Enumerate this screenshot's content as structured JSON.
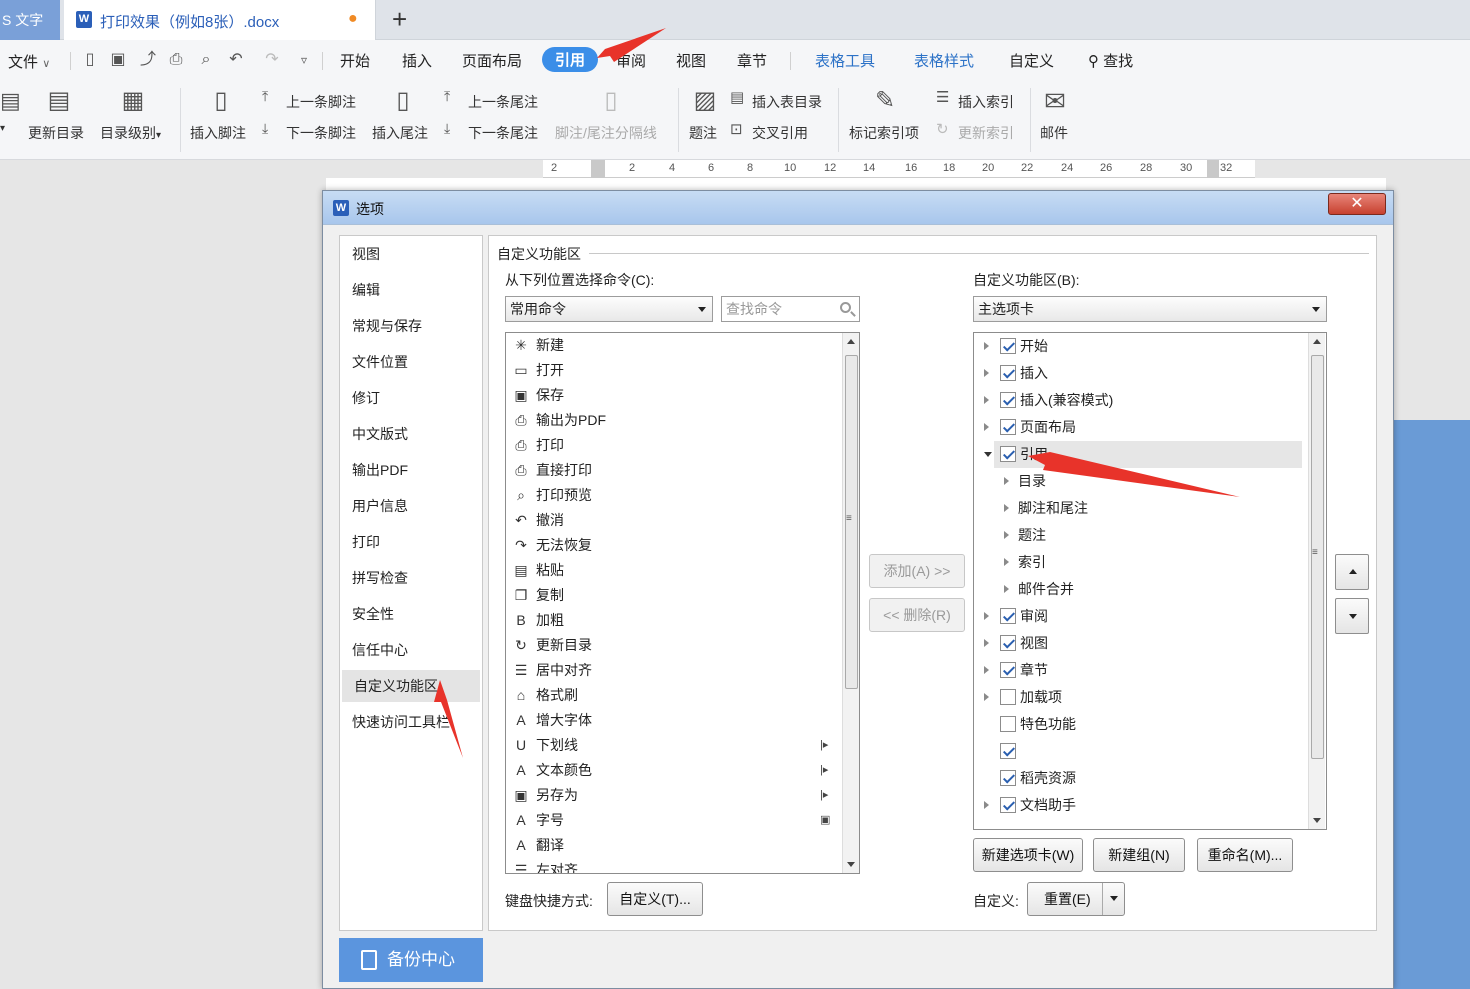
{
  "tabs": {
    "app_label": "S 文字",
    "doc_title": "打印效果（例如8张）.docx",
    "new_tab": "+"
  },
  "menu": {
    "file": "文件",
    "items": [
      "开始",
      "插入",
      "页面布局",
      "引用",
      "审阅",
      "视图",
      "章节",
      "表格工具",
      "表格样式",
      "自定义"
    ],
    "search": "查找"
  },
  "ribbon": {
    "update_toc": "更新目录",
    "toc_level": "目录级别",
    "insert_footnote": "插入脚注",
    "prev_footnote": "上一条脚注",
    "next_footnote": "下一条脚注",
    "insert_endnote": "插入尾注",
    "prev_endnote": "上一条尾注",
    "next_endnote": "下一条尾注",
    "separator": "脚注/尾注分隔线",
    "caption": "题注",
    "insert_table_of_figures": "插入表目录",
    "cross_ref": "交叉引用",
    "mark_index": "标记索引项",
    "insert_index": "插入索引",
    "update_index": "更新索引",
    "mail": "邮件"
  },
  "ruler": {
    "ticks": [
      "2",
      "2",
      "4",
      "6",
      "8",
      "10",
      "12",
      "14",
      "16",
      "18",
      "20",
      "22",
      "24",
      "26",
      "28",
      "30",
      "32"
    ]
  },
  "dialog": {
    "title": "选项",
    "close": "✕",
    "nav": [
      "视图",
      "编辑",
      "常规与保存",
      "文件位置",
      "修订",
      "中文版式",
      "输出PDF",
      "用户信息",
      "打印",
      "拼写检查",
      "安全性",
      "信任中心",
      "自定义功能区",
      "快速访问工具栏"
    ],
    "nav_selected": "自定义功能区",
    "backup": "备份中心",
    "section_title": "自定义功能区",
    "choose_from_label": "从下列位置选择命令(C):",
    "choose_from_value": "常用命令",
    "search_placeholder": "查找命令",
    "customize_label": "自定义功能区(B):",
    "customize_value": "主选项卡",
    "commands": [
      {
        "icon": "new-doc-icon",
        "glyph": "✳",
        "label": "新建",
        "sub": ""
      },
      {
        "icon": "open-folder-icon",
        "glyph": "▭",
        "label": "打开",
        "sub": ""
      },
      {
        "icon": "save-icon",
        "glyph": "▣",
        "label": "保存",
        "sub": ""
      },
      {
        "icon": "pdf-icon",
        "glyph": "⎙",
        "label": "输出为PDF",
        "sub": ""
      },
      {
        "icon": "print-icon",
        "glyph": "⎙",
        "label": "打印",
        "sub": ""
      },
      {
        "icon": "direct-print-icon",
        "glyph": "⎙",
        "label": "直接打印",
        "sub": ""
      },
      {
        "icon": "print-preview-icon",
        "glyph": "⌕",
        "label": "打印预览",
        "sub": ""
      },
      {
        "icon": "undo-icon",
        "glyph": "↶",
        "label": "撤消",
        "sub": ""
      },
      {
        "icon": "redo-icon",
        "glyph": "↷",
        "label": "无法恢复",
        "sub": ""
      },
      {
        "icon": "paste-icon",
        "glyph": "▤",
        "label": "粘贴",
        "sub": ""
      },
      {
        "icon": "copy-icon",
        "glyph": "❐",
        "label": "复制",
        "sub": ""
      },
      {
        "icon": "bold-icon",
        "glyph": "B",
        "label": "加粗",
        "sub": ""
      },
      {
        "icon": "update-toc-icon",
        "glyph": "↻",
        "label": "更新目录",
        "sub": ""
      },
      {
        "icon": "align-center-icon",
        "glyph": "☰",
        "label": "居中对齐",
        "sub": ""
      },
      {
        "icon": "format-painter-icon",
        "glyph": "⌂",
        "label": "格式刷",
        "sub": ""
      },
      {
        "icon": "grow-font-icon",
        "glyph": "A",
        "label": "增大字体",
        "sub": ""
      },
      {
        "icon": "underline-icon",
        "glyph": "U",
        "label": "下划线",
        "sub": "|▸"
      },
      {
        "icon": "font-color-icon",
        "glyph": "A",
        "label": "文本颜色",
        "sub": "|▸"
      },
      {
        "icon": "save-as-icon",
        "glyph": "▣",
        "label": "另存为",
        "sub": "|▸"
      },
      {
        "icon": "font-size-icon",
        "glyph": "A",
        "label": "字号",
        "sub": "▣"
      },
      {
        "icon": "translate-icon",
        "glyph": "A",
        "label": "翻译",
        "sub": ""
      },
      {
        "icon": "align-left-icon",
        "glyph": "☰",
        "label": "左对齐",
        "sub": ""
      }
    ],
    "add_button": "添加(A) >>",
    "remove_button": "<< 删除(R)",
    "tree": [
      {
        "label": "开始",
        "level": 0,
        "toggle": "collapsed",
        "checked": true
      },
      {
        "label": "插入",
        "level": 0,
        "toggle": "collapsed",
        "checked": true
      },
      {
        "label": "插入(兼容模式)",
        "level": 0,
        "toggle": "collapsed",
        "checked": true
      },
      {
        "label": "页面布局",
        "level": 0,
        "toggle": "collapsed",
        "checked": true
      },
      {
        "label": "引用",
        "level": 0,
        "toggle": "expanded",
        "checked": true,
        "selected": true
      },
      {
        "label": "目录",
        "level": 1,
        "toggle": "collapsed"
      },
      {
        "label": "脚注和尾注",
        "level": 1,
        "toggle": "collapsed"
      },
      {
        "label": "题注",
        "level": 1,
        "toggle": "collapsed"
      },
      {
        "label": "索引",
        "level": 1,
        "toggle": "collapsed"
      },
      {
        "label": "邮件合并",
        "level": 1,
        "toggle": "collapsed"
      },
      {
        "label": "审阅",
        "level": 0,
        "toggle": "collapsed",
        "checked": true
      },
      {
        "label": "视图",
        "level": 0,
        "toggle": "collapsed",
        "checked": true
      },
      {
        "label": "章节",
        "level": 0,
        "toggle": "collapsed",
        "checked": true
      },
      {
        "label": "加载项",
        "level": 0,
        "toggle": "collapsed",
        "checked": false
      },
      {
        "label": "特色功能",
        "level": 0,
        "toggle": "none",
        "checked": false
      },
      {
        "label": "",
        "level": 0,
        "toggle": "none",
        "checked": true
      },
      {
        "label": "稻壳资源",
        "level": 0,
        "toggle": "none",
        "checked": true
      },
      {
        "label": "文档助手",
        "level": 0,
        "toggle": "collapsed",
        "checked": true
      }
    ],
    "new_tab_button": "新建选项卡(W)",
    "new_group_button": "新建组(N)",
    "rename_button": "重命名(M)...",
    "shortcut_label": "键盘快捷方式:",
    "shortcut_button": "自定义(T)...",
    "custom_label": "自定义:",
    "reset_button": "重置(E)"
  },
  "colors": {
    "accent": "#3b8ee8",
    "annotation_arrow": "#e8332a",
    "backup_bg": "#5b95de"
  }
}
